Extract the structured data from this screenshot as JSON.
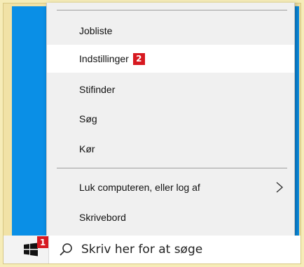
{
  "menu": {
    "items": [
      {
        "label": "Jobliste"
      },
      {
        "label": "Indstillinger",
        "badge": "2"
      },
      {
        "label": "Stifinder"
      },
      {
        "label": "Søg"
      },
      {
        "label": "Kør"
      },
      {
        "label": "Luk computeren, eller log af",
        "submenu_icon": "chevron-right-icon"
      },
      {
        "label": "Skrivebord"
      }
    ]
  },
  "taskbar": {
    "start_badge": "1",
    "search_placeholder": "Skriv her for at søge"
  },
  "colors": {
    "desktop": "#0a8fe6",
    "badge": "#d71920",
    "menu_bg": "#f0f0f0",
    "highlight": "#ffffff"
  }
}
